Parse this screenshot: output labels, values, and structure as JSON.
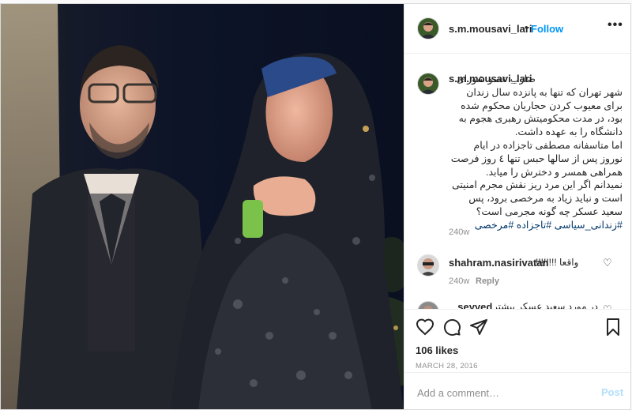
{
  "header": {
    "username": "s.m.mousavi_lari",
    "separator": "•",
    "follow_label": "Follow",
    "more_icon": "more-horizontal-icon"
  },
  "caption": {
    "username": "s.m.mousavi_lari",
    "text_first": "ضارب عضو شورای",
    "text_rest": "شهر تهران که تنها به پانزده سال زندان برای معیوب کردن حجاریان محکوم شده بود، در مدت محکومیتش رهبری هجوم به دانشگاه را به عهده داشت.\nاما متاسفانه مصطفی تاجزاده در ایام نوروز پس از سالها حبس تنها ٤ روز فرصت همراهی همسر و دخترش را میابد.\nنمیدانم اگر این مرد ریز نقش مجرم امنیتی است و نباید زیاد به مرخصی برود، پس سعید عسکر چه گونه مجرمی است؟",
    "hashtags": "#زندانی_سیاسی #تاجزاده #مرخصی",
    "time": "240w"
  },
  "comments": [
    {
      "username": "shahram.nasirivatan",
      "text": "واقعا !!!!!!!!",
      "time": "240w",
      "reply_label": "Reply"
    },
    {
      "username": "_seyyed",
      "text": "در مورد سعید عسکر بیشتر"
    }
  ],
  "actions": {
    "like_icon": "heart-icon",
    "comment_icon": "comment-icon",
    "share_icon": "paper-plane-icon",
    "save_icon": "bookmark-icon"
  },
  "likes": "106 likes",
  "date": "MARCH 28, 2016",
  "composer": {
    "placeholder": "Add a comment…",
    "post_label": "Post"
  },
  "colors": {
    "accent": "#0095f6",
    "post_disabled": "#b2dffc",
    "muted": "#8e8e8e",
    "hashtag": "#00376b"
  }
}
